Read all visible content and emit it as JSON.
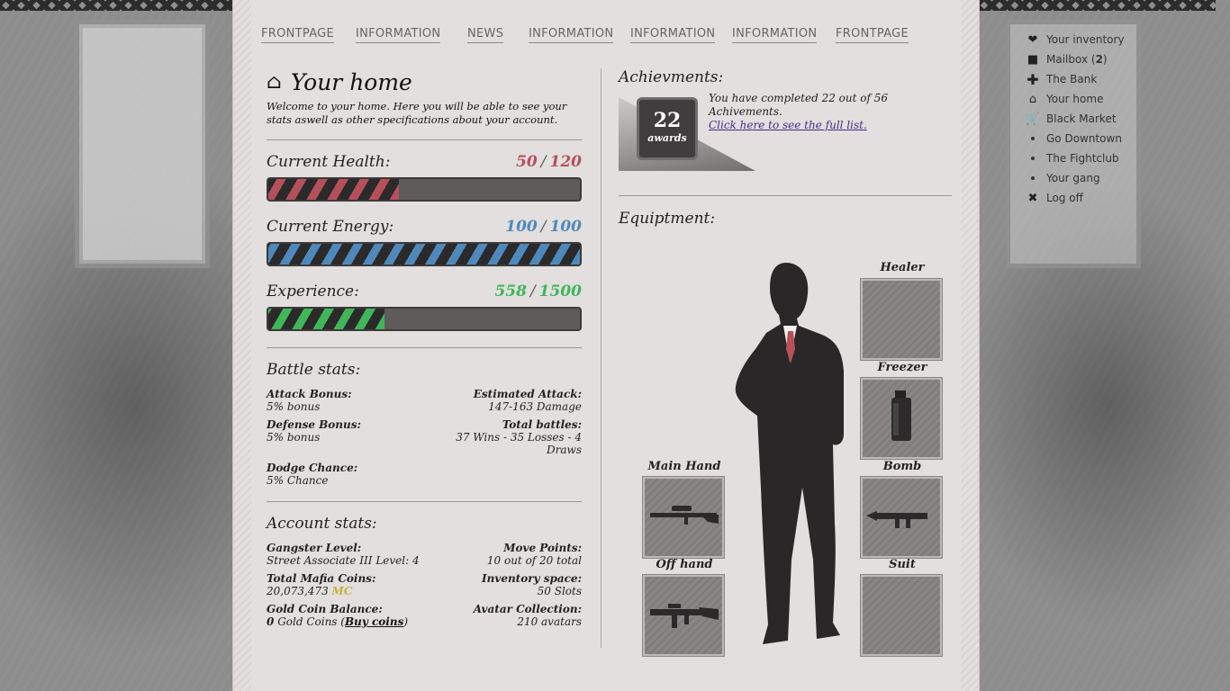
{
  "nav": [
    "FRONTPAGE",
    "INFORMATION",
    "NEWS",
    "INFORMATION",
    "INFORMATION",
    "INFORMATION",
    "FRONTPAGE"
  ],
  "side_menu": {
    "inventory": "Your inventory",
    "mailbox": "Mailbox (",
    "mailbox_count": "2",
    "mailbox_close": ")",
    "bank": "The Bank",
    "home": "Your home",
    "market": "Black Market",
    "downtown": "Go Downtown",
    "fightclub": "The Fightclub",
    "gang": "Your gang",
    "logoff": "Log off"
  },
  "home": {
    "title": "Your home",
    "welcome": "Welcome to your home. Here you will be able to see your stats aswell as other specifications about your account."
  },
  "health": {
    "label": "Current Health:",
    "current": "50",
    "max": "120",
    "sep": "/",
    "color": "#b5505b",
    "fraction": 0.42
  },
  "energy": {
    "label": "Current Energy:",
    "current": "100",
    "max": "100",
    "sep": "/",
    "color": "#4f89bb",
    "fraction": 1.0
  },
  "experience": {
    "label": "Experience:",
    "current": "558",
    "max": "1500",
    "sep": "/",
    "color": "#3fb65a",
    "fraction": 0.372
  },
  "battle": {
    "title": "Battle stats:",
    "attack_label": "Attack Bonus:",
    "attack_val": "5% bonus",
    "est_label": "Estimated Attack:",
    "est_val": "147-163 Damage",
    "defense_label": "Defense Bonus:",
    "defense_val": "5% bonus",
    "battles_label": "Total battles:",
    "battles_val": "37 Wins - 35 Losses - 4 Draws",
    "dodge_label": "Dodge Chance:",
    "dodge_val": "5% Chance"
  },
  "account": {
    "title": "Account stats:",
    "level_label": "Gangster Level:",
    "level_val": "Street Associate III Level: 4",
    "move_label": "Move Points:",
    "move_val": "10 out of 20 total",
    "coins_label": "Total Mafia Coins:",
    "coins_val": "20,073,473",
    "coins_unit": "MC",
    "inv_label": "Inventory space:",
    "inv_val": "50 Slots",
    "gold_label": "Gold Coin Balance:",
    "gold_count": "0",
    "gold_text": "Gold Coins (",
    "buy": "Buy coins",
    "gold_close": ")",
    "avatar_label": "Avatar Collection:",
    "avatar_val": "210 avatars"
  },
  "achievements": {
    "title": "Achievments:",
    "count": "22",
    "badge_sub": "awards",
    "text": "You have completed 22 out of 56 Achivements.",
    "link": "Click here to see the full list."
  },
  "equipment": {
    "title": "Equiptment:",
    "healer": "Healer",
    "freezer": "Freezer",
    "bomb": "Bomb",
    "suit": "Suit",
    "main_hand": "Main Hand",
    "off_hand": "Off hand"
  }
}
